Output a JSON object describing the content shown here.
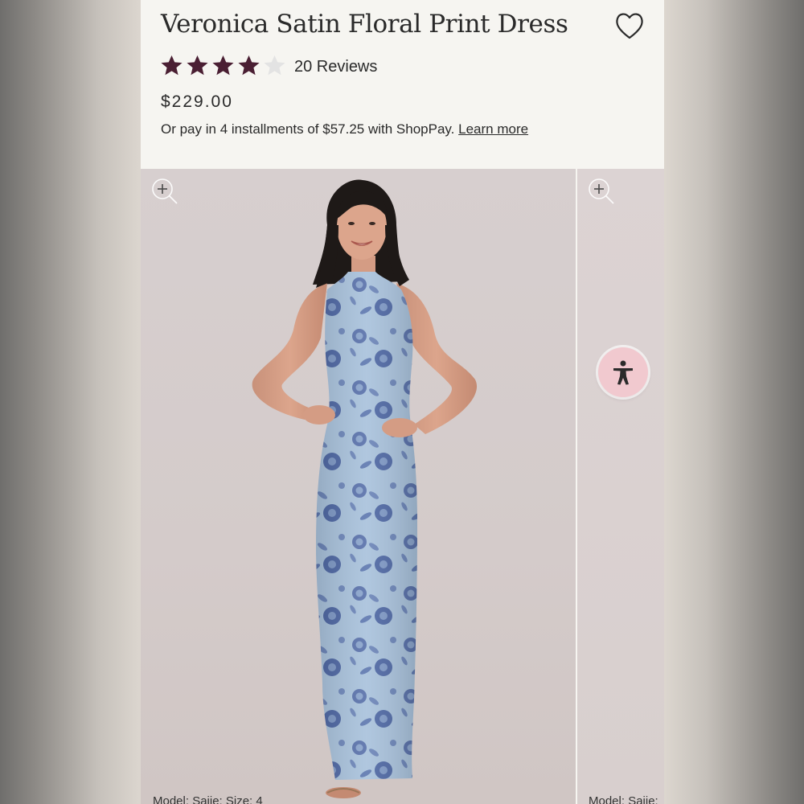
{
  "product": {
    "title": "Veronica Satin Floral Print Dress",
    "rating": 4,
    "rating_max": 5,
    "reviews_label": "20 Reviews",
    "price": "$229.00",
    "installments_text": "Or pay in 4 installments of $57.25 with ShopPay.",
    "learn_more_label": "Learn more"
  },
  "gallery": {
    "slides": [
      {
        "caption": "Model: Saije; Size: 4"
      },
      {
        "caption": "Model: Saije;"
      }
    ]
  },
  "icons": {
    "wishlist": "heart-outline-icon",
    "zoom": "zoom-in-icon",
    "accessibility": "accessibility-icon",
    "rating": "star-icon"
  },
  "colors": {
    "star_filled": "#4a1f33",
    "star_empty": "#e3e3e3",
    "accessibility_bg": "#f1c9cf",
    "dress_base": "#a9c2dc",
    "dress_print": "#5a72ab"
  }
}
